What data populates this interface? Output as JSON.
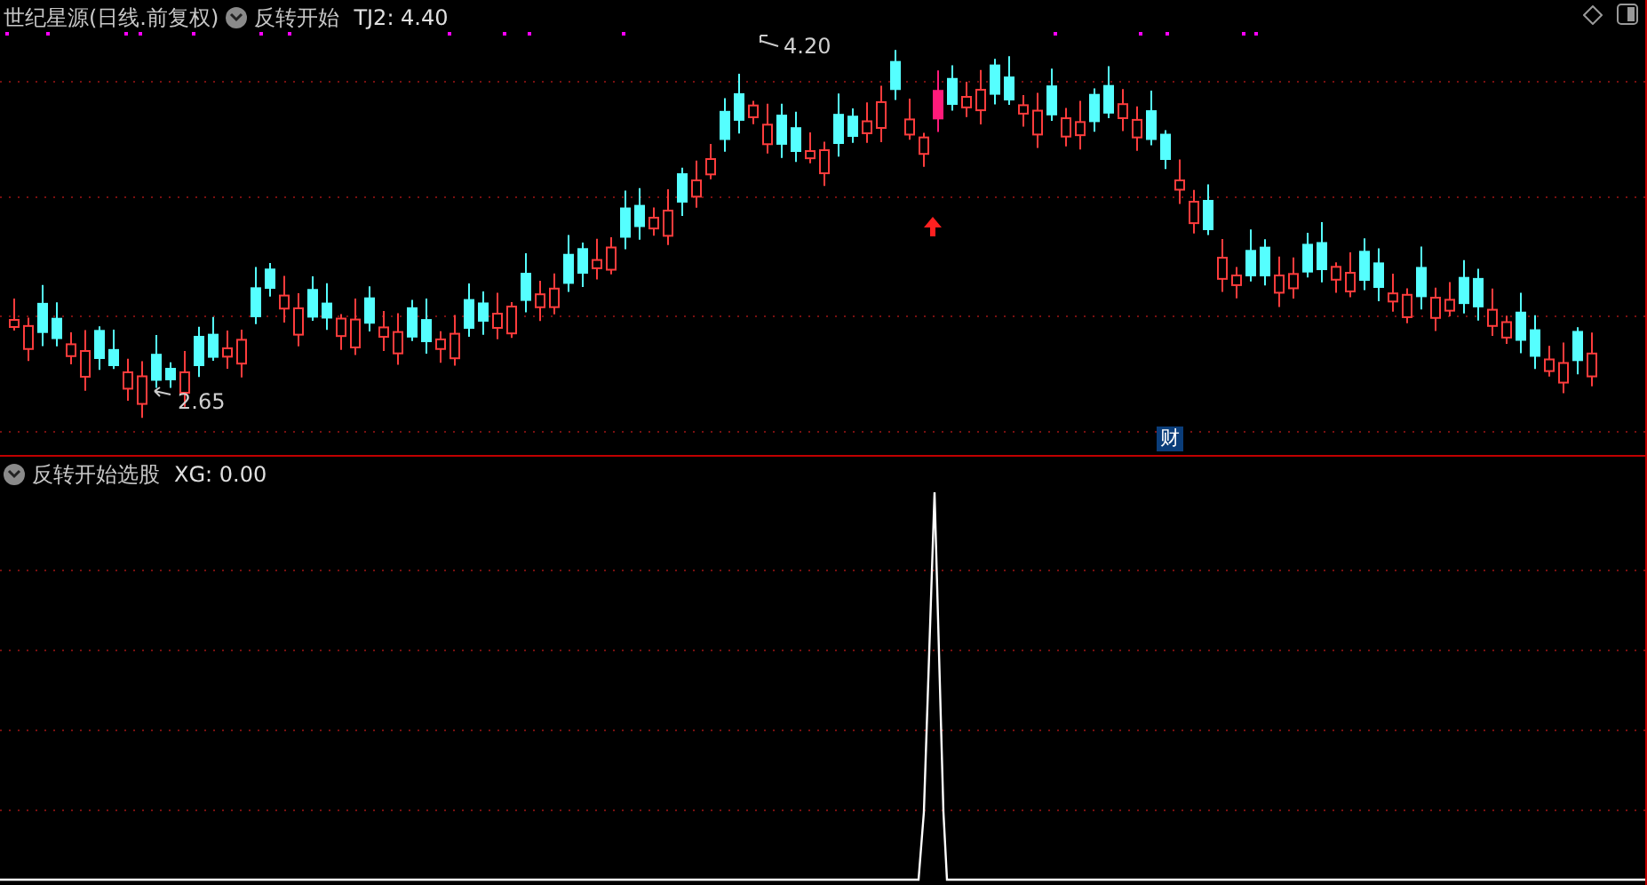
{
  "main_panel": {
    "stock_name": "世纪星源(日线.前复权)",
    "indicator": "反转开始",
    "indicator_value": "TJ2: 4.40",
    "high_label": "4.20",
    "low_label": "2.65",
    "event_badge": "财"
  },
  "sub_panel": {
    "indicator": "反转开始选股",
    "indicator_value": "XG: 0.00"
  }
}
